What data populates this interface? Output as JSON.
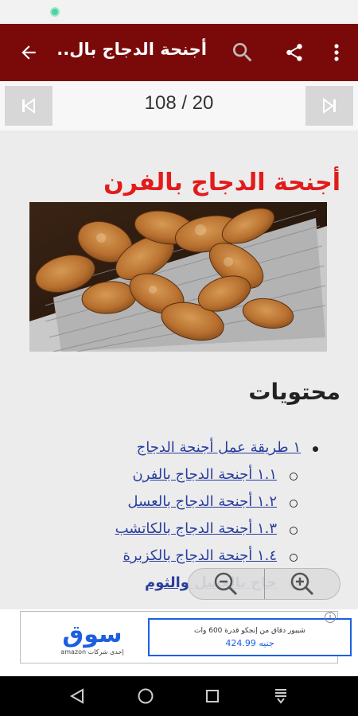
{
  "app_bar": {
    "title": "أجنحة الدجاج بال..",
    "colors": {
      "background": "#7a0a0a",
      "text": "#ffffff"
    },
    "icons": [
      "back-arrow-icon",
      "search-icon",
      "share-icon",
      "more-vert-icon"
    ]
  },
  "pager": {
    "counter": "108 / 20",
    "icons": [
      "skip-previous-icon",
      "skip-next-icon"
    ]
  },
  "article": {
    "title": "أجنحة الدجاج بالفرن",
    "title_color": "#e31b1b"
  },
  "toc": {
    "heading": "محتويات",
    "items": [
      {
        "label": "١ طريقة عمل أجنحة الدجاج"
      },
      {
        "label": "١.١ أجنحة الدجاج بالفرن"
      },
      {
        "label": "١.٢ أجنحة الدجاج بالعسل"
      },
      {
        "label": "١.٣ أجنحة الدجاج بالكاتشب"
      },
      {
        "label": "١.٤ أجنحة الدجاج بالكزبرة"
      },
      {
        "label": "جاج بالعسل والثوم"
      }
    ],
    "link_color": "#2a3e9e"
  },
  "zoom": {
    "icons": [
      "zoom-out-icon",
      "zoom-in-icon"
    ]
  },
  "ad": {
    "brand": "سوق",
    "brand_sub": "amazon إحدى شركات",
    "description": "شيبور دفاق من إنجكو قدرة 600 وات",
    "price": "جنيه 424.99",
    "info": "i",
    "brand_color": "#1d5fe3"
  },
  "nav_bar": {
    "icons": [
      "back-triangle-icon",
      "home-circle-icon",
      "recents-square-icon",
      "keyboard-hide-icon"
    ]
  }
}
